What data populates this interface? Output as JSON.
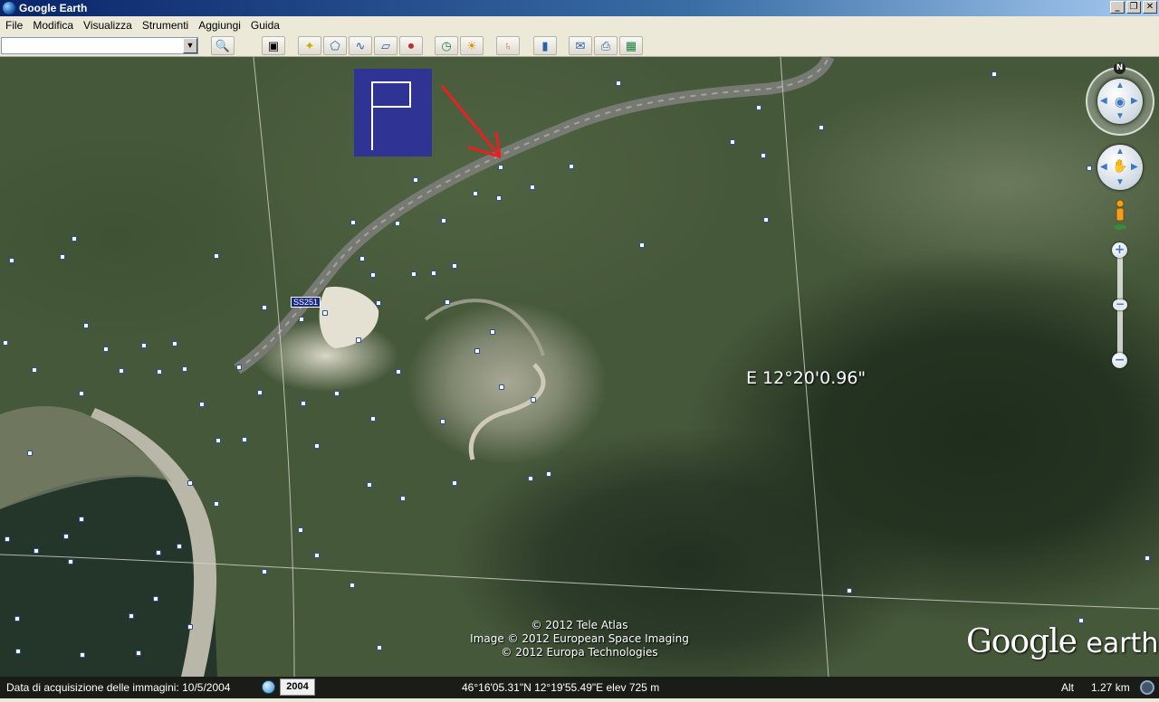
{
  "window": {
    "title": "Google Earth",
    "buttons": [
      "_",
      "❐",
      "✕"
    ]
  },
  "menu": [
    "File",
    "Modifica",
    "Visualizza",
    "Strumenti",
    "Aggiungi",
    "Guida"
  ],
  "toolbar": {
    "search_value": "",
    "buttons": [
      {
        "name": "search-button",
        "glyph": "🔍"
      },
      {
        "name": "sidebar-toggle-button",
        "glyph": "▣"
      },
      {
        "name": "add-placemark-button",
        "glyph": "✦"
      },
      {
        "name": "add-polygon-button",
        "glyph": "⬠"
      },
      {
        "name": "add-path-button",
        "glyph": "∿"
      },
      {
        "name": "add-overlay-button",
        "glyph": "▱"
      },
      {
        "name": "record-tour-button",
        "glyph": "⏺"
      },
      {
        "name": "historical-imagery-button",
        "glyph": "◷"
      },
      {
        "name": "sunlight-button",
        "glyph": "☀"
      },
      {
        "name": "switch-planet-button",
        "glyph": "♄"
      },
      {
        "name": "ruler-button",
        "glyph": "▮"
      },
      {
        "name": "email-button",
        "glyph": "✉"
      },
      {
        "name": "print-button",
        "glyph": "⎙"
      },
      {
        "name": "view-in-maps-button",
        "glyph": "▦"
      }
    ]
  },
  "map": {
    "road_label": "SS251",
    "coordinate_label": "E 12°20'0.96\"",
    "copyright": [
      "© 2012 Tele Atlas",
      "Image © 2012 European Space Imaging",
      "© 2012 Europa Technologies"
    ],
    "logo_google": "Google",
    "logo_earth": "earth",
    "compass_letter": "N",
    "zoom_in": "+",
    "zoom_out": "−",
    "flag_color": "#2f3394",
    "arrow_color": "#e82020"
  },
  "status": {
    "imagery_date": "Data di acquisizione delle immagini: 10/5/2004",
    "year": "2004",
    "coords": "46°16'05.31\"N   12°19'55.49\"E  elev   725 m",
    "eye_alt_label": "Alt",
    "eye_alt_value": "1.27 km"
  }
}
